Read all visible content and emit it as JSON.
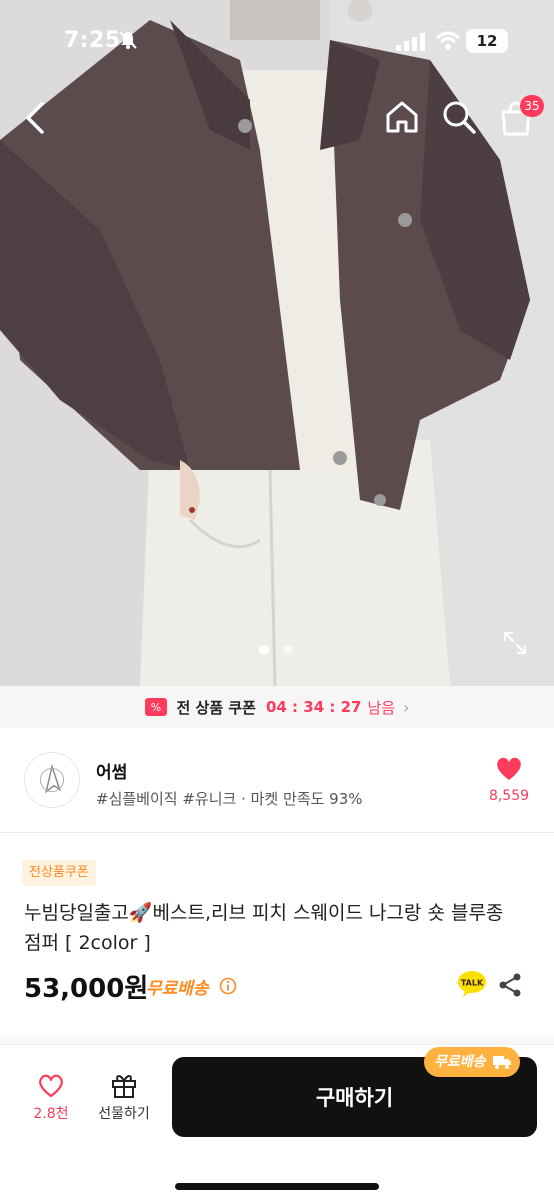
{
  "status_bar": {
    "time": "7:25",
    "battery": "12"
  },
  "nav": {
    "cart_badge": "35"
  },
  "carousel": {
    "pages": 2,
    "active": 0
  },
  "coupon_banner": {
    "label": "전 상품 쿠폰",
    "timer": "04 : 34 : 27",
    "suffix": "남음"
  },
  "seller": {
    "name": "어썸",
    "meta": "#심플베이직 #유니크 · 마켓 만족도 93%",
    "likes": "8,559"
  },
  "product": {
    "tag": "전상품쿠폰",
    "title": "누빔당일출고🚀베스트,리브 피치 스웨이드 나그랑 숏 블루종 점퍼 [ 2color ]",
    "price": "53,000원",
    "shipping": "무료배송"
  },
  "bottom_bar": {
    "likes": "2.8천",
    "gift_label": "선물하기",
    "buy_label": "구매하기",
    "ship_chip": "무료배송"
  },
  "colors": {
    "accent_pink": "#ff3b5c",
    "accent_orange": "#ff8a1e",
    "jacket": "#5a4a4c"
  }
}
